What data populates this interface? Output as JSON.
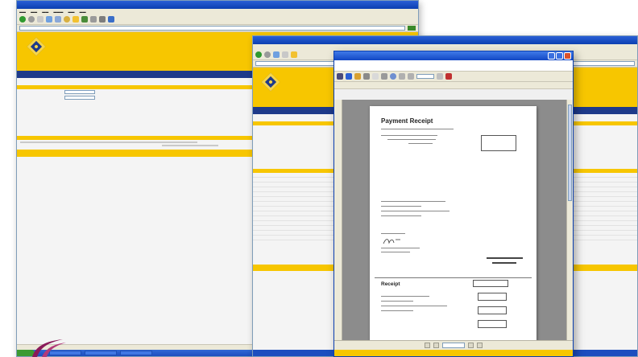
{
  "receipt": {
    "title": "Payment Receipt",
    "section_title": "Receipt"
  },
  "colors": {
    "brand_yellow": "#f7c600",
    "brand_navy": "#1e3a8a",
    "titlebar_blue": "#0b3fb0"
  },
  "icons": [
    "back-icon",
    "forward-icon",
    "refresh-icon",
    "home-icon",
    "search-icon",
    "favorites-icon",
    "print-icon",
    "save-icon",
    "zoom-icon",
    "page-nav-icon",
    "close-icon",
    "maximize-icon",
    "minimize-icon",
    "company-logo"
  ]
}
